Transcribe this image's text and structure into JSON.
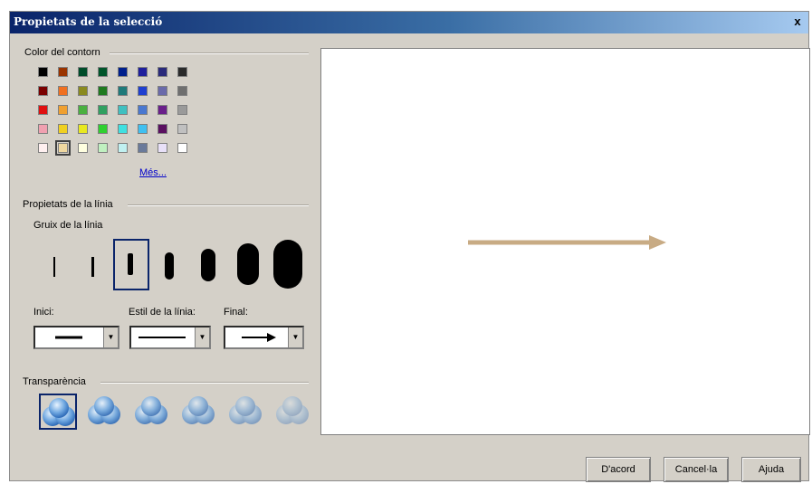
{
  "window": {
    "title": "Propietats de la selecció",
    "close_label": "x"
  },
  "color_group": {
    "label": "Color del contorn",
    "more_link": "Més...",
    "swatches": [
      [
        "#000000",
        "#9a3400",
        "#004d2a",
        "#00552a",
        "#001f8c",
        "#1f1f9c",
        "#2a2a7a",
        "#2a2a2a"
      ],
      [
        "#7a0000",
        "#f07020",
        "#8a8a1f",
        "#1f7a1f",
        "#1f7a7a",
        "#1f3fd0",
        "#6a6aaa",
        "#6f6f6f"
      ],
      [
        "#e01010",
        "#f0a030",
        "#4ab040",
        "#30a060",
        "#40c0c0",
        "#4a78d0",
        "#6a1f8a",
        "#9a9a9a"
      ],
      [
        "#f0a0b0",
        "#f0d020",
        "#e8e820",
        "#30d030",
        "#40e0e0",
        "#40c0f0",
        "#5a1060",
        "#c0c0c0"
      ],
      [
        "#fff0f0",
        "#f0d8a0",
        "#ffffe0",
        "#c0f0c0",
        "#c0f0f0",
        "#6a7a9a",
        "#e8e0f8",
        "#ffffff"
      ]
    ],
    "selected_swatch": "row5-col2"
  },
  "line_group": {
    "label": "Propietats de la línia",
    "thickness_label": "Gruix de la línia",
    "selected_thickness": "3",
    "start_label": "Inici:",
    "style_label": "Estil de la línia:",
    "end_label": "Final:"
  },
  "transparency_group": {
    "label": "Transparència",
    "selected_level": "1"
  },
  "preview": {
    "arrow_color": "#c8ab84"
  },
  "buttons": {
    "ok": "D'acord",
    "cancel": "Cancel·la",
    "help": "Ajuda"
  }
}
